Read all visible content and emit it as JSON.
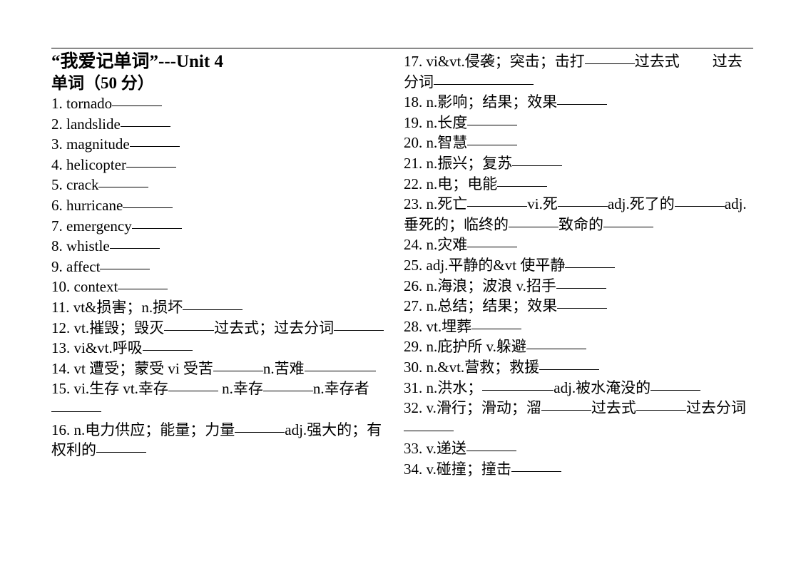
{
  "document": {
    "title": "“我爱记单词”---Unit 4",
    "subtitle": "单词（50 分）"
  },
  "left_column": {
    "items": [
      {
        "num": "1.",
        "text": "tornado"
      },
      {
        "num": "2.",
        "text": "landslide"
      },
      {
        "num": "3.",
        "text": "magnitude"
      },
      {
        "num": "4.",
        "text": "helicopter"
      },
      {
        "num": "5.",
        "text": "crack"
      },
      {
        "num": "6.",
        "text": "hurricane"
      },
      {
        "num": "7.",
        "text": "emergency"
      },
      {
        "num": "8.",
        "text": "whistle"
      },
      {
        "num": "9.",
        "text": "affect"
      },
      {
        "num": "10.",
        "text": "context"
      },
      {
        "num": "11.",
        "text": "vt&损害；n.损坏"
      },
      {
        "num": "12.",
        "text": "vt.摧毁；毁灭",
        "text2": "过去式；过去分词"
      },
      {
        "num": "13.",
        "text": "vi&vt.呼吸"
      },
      {
        "num": "14.",
        "text": "vt 遭受；蒙受 vi 受苦",
        "text2": "n.苦难"
      },
      {
        "num": "15.",
        "text": "vi.生存 vt.幸存",
        "text2": "n.幸存",
        "text3": "n.幸存者"
      },
      {
        "num": "16.",
        "text": "n.电力供应；能量；力量",
        "text2": "adj.强大的；有权利的"
      }
    ]
  },
  "right_column": {
    "items": [
      {
        "num": "17.",
        "text": "vi&vt.侵袭；突击；击打",
        "text2": "过去式",
        "text3": "过去分词"
      },
      {
        "num": "18.",
        "text": "n.影响；结果；效果"
      },
      {
        "num": "19.",
        "text": "n.长度"
      },
      {
        "num": "20.",
        "text": "n.智慧"
      },
      {
        "num": "21.",
        "text": "n.振兴；复苏"
      },
      {
        "num": "22.",
        "text": "n.电；电能"
      },
      {
        "num": "23.",
        "text": "n.死亡",
        "text2": "vi.死",
        "text3": "adj.死了的",
        "text4": "adj.垂死的；临终的",
        "text5": "致命的"
      },
      {
        "num": "24.",
        "text": "n.灾难"
      },
      {
        "num": "25.",
        "text": "adj.平静的&vt 使平静"
      },
      {
        "num": "26.",
        "text": "n.海浪；波浪 v.招手"
      },
      {
        "num": "27.",
        "text": "n.总结；结果；效果"
      },
      {
        "num": "28.",
        "text": "vt.埋葬"
      },
      {
        "num": "29.",
        "text": "n.庇护所 v.躲避"
      },
      {
        "num": "30.",
        "text": "n.&vt.营救；救援"
      },
      {
        "num": "31.",
        "text": "n.洪水；",
        "text2": "adj.被水淹没的"
      },
      {
        "num": "32.",
        "text": "v.滑行；滑动；溜",
        "text2": "过去式",
        "text3": "过去分词"
      },
      {
        "num": "33.",
        "text": "v.递送"
      },
      {
        "num": "34.",
        "text": "v.碰撞；撞击"
      }
    ]
  },
  "style": {
    "ink_color": "#000000",
    "paper_color": "#ffffff"
  }
}
